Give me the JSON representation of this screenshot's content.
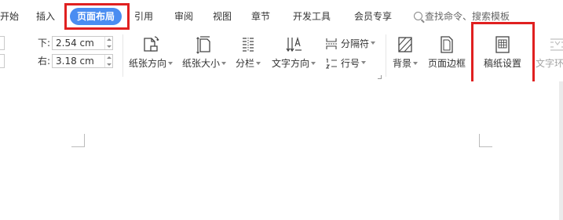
{
  "tabs": [
    {
      "label": "开始"
    },
    {
      "label": "插入"
    },
    {
      "label": "页面布局",
      "active": true
    },
    {
      "label": "引用"
    },
    {
      "label": "审阅"
    },
    {
      "label": "视图"
    },
    {
      "label": "章节"
    },
    {
      "label": "开发工具"
    },
    {
      "label": "会员专享"
    }
  ],
  "search": {
    "label": "查找命令、搜索模板"
  },
  "margins": {
    "bottom": {
      "label": "下:",
      "value": "2.54 cm"
    },
    "right": {
      "label": "右:",
      "value": "3.18 cm"
    }
  },
  "ribbon": {
    "orientation": "纸张方向",
    "size": "纸张大小",
    "columns": "分栏",
    "text_direction": "文字方向",
    "separator": "分隔符",
    "line_numbers": "行号",
    "background": "背景",
    "page_border": "页面边框",
    "manuscript": "稿纸设置",
    "text_wrap": "文字环"
  },
  "colors": {
    "accent": "#4a8df1",
    "highlight": "#e02020",
    "doc_bg": "#ebebeb"
  }
}
